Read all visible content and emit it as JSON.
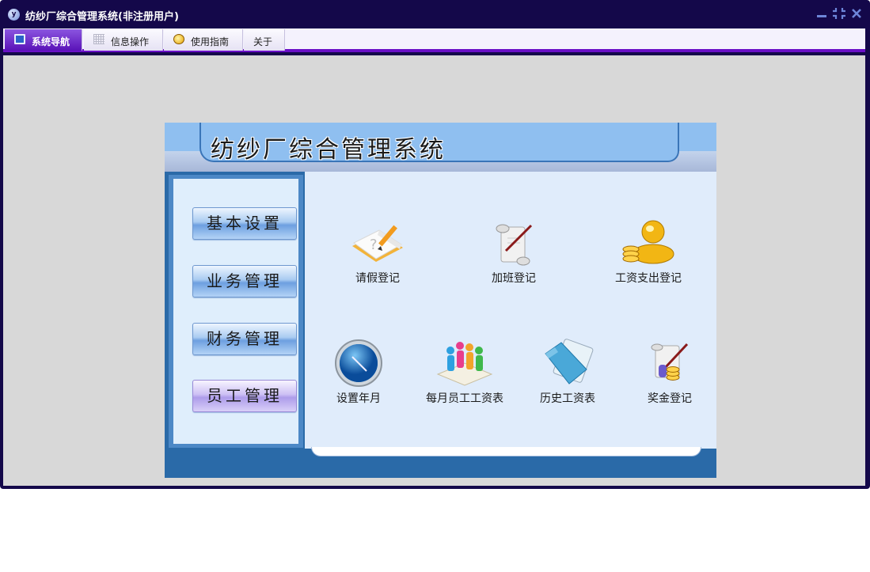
{
  "window": {
    "title": "纺纱厂综合管理系统(非注册用户)",
    "app_icon_letter": "y"
  },
  "tabs": [
    {
      "label": "系统导航",
      "icon": "monitor-icon",
      "active": true
    },
    {
      "label": "信息操作",
      "icon": "grid-icon",
      "active": false
    },
    {
      "label": "使用指南",
      "icon": "lightbulb-icon",
      "active": false
    },
    {
      "label": "关于",
      "icon": "",
      "active": false
    }
  ],
  "panel": {
    "title": "纺纱厂综合管理系统"
  },
  "sidebar": {
    "buttons": [
      {
        "label": "基本设置"
      },
      {
        "label": "业务管理"
      },
      {
        "label": "财务管理"
      },
      {
        "label": "员工管理"
      }
    ]
  },
  "functions": [
    {
      "label": "请假登记",
      "icon": "notebook-pencil-icon"
    },
    {
      "label": "加班登记",
      "icon": "scroll-quill-icon"
    },
    {
      "label": "工资支出登记",
      "icon": "gold-coins-person-icon"
    },
    {
      "label": "设置年月",
      "icon": "clock-icon"
    },
    {
      "label": "每月员工工资表",
      "icon": "people-group-icon"
    },
    {
      "label": "历史工资表",
      "icon": "blue-folder-icon"
    },
    {
      "label": "奖金登记",
      "icon": "scroll-coins-icon"
    }
  ],
  "colors": {
    "titlebar": "#14084a",
    "tab_active": "#6a0fc7",
    "panel_blue": "#2a6aa8",
    "banner_blue": "#8fbff0",
    "main_bg": "#e0ecfb"
  }
}
